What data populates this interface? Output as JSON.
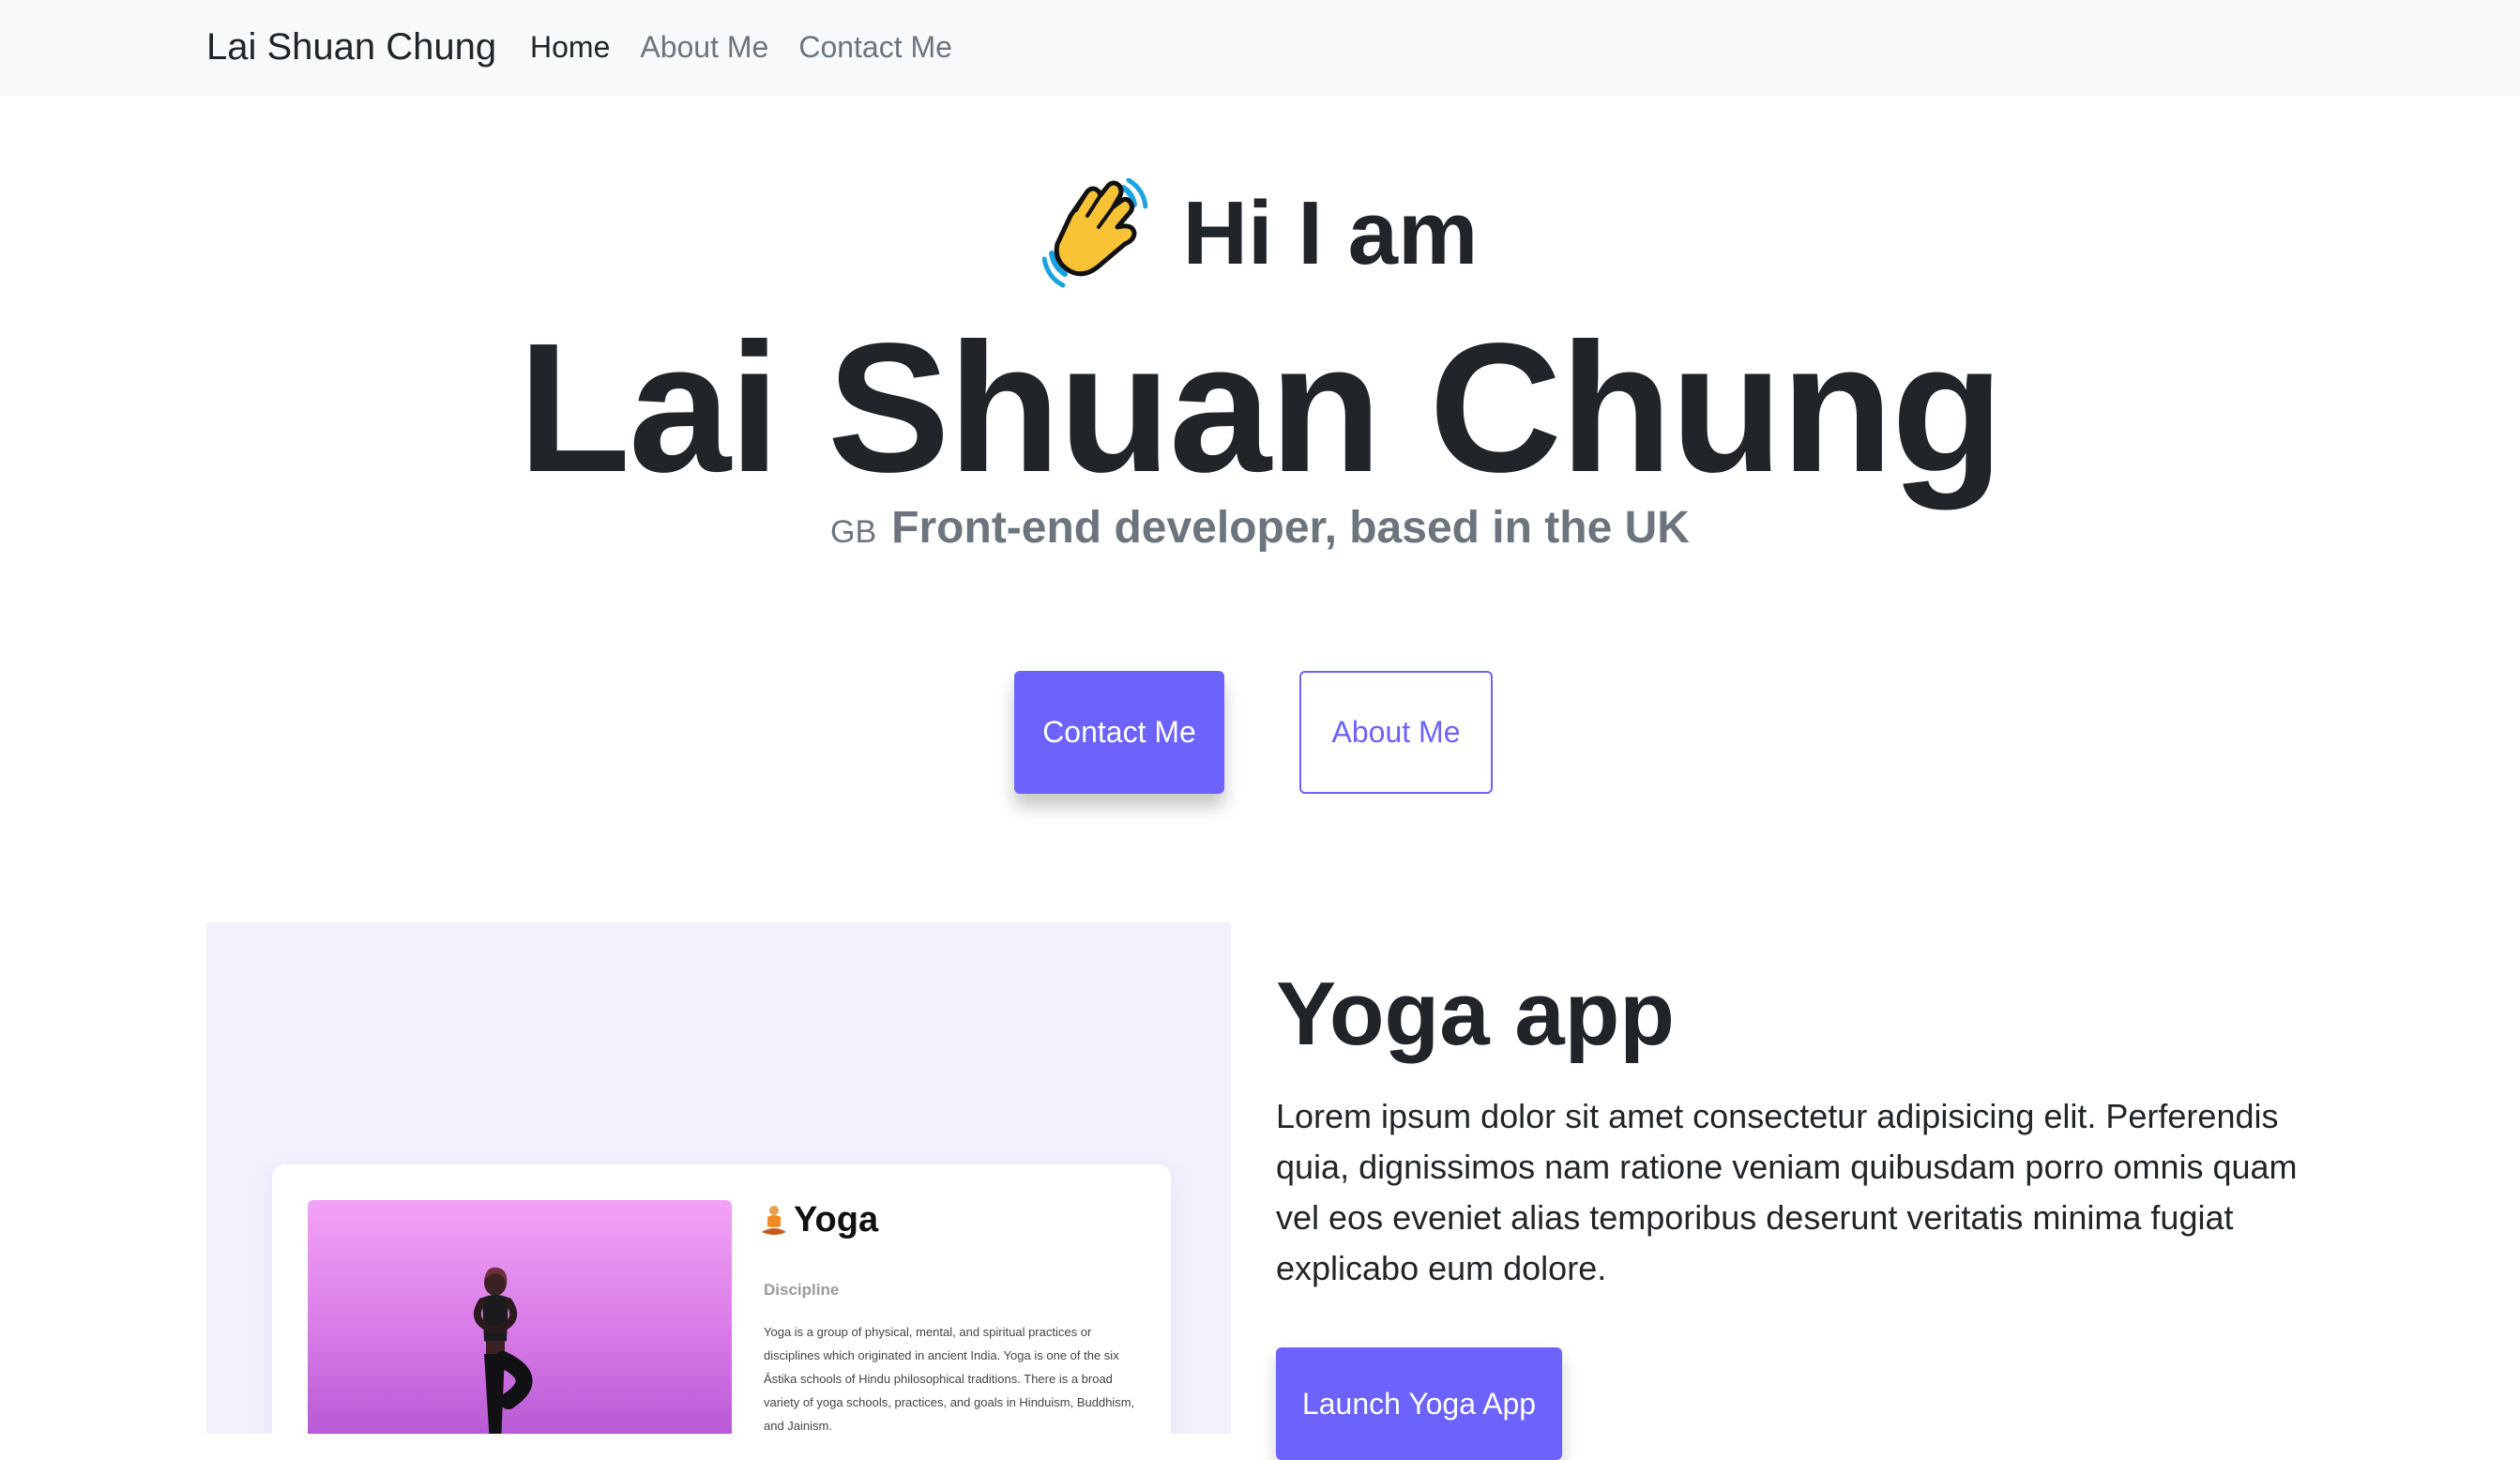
{
  "navbar": {
    "brand": "Lai Shuan Chung",
    "links": [
      {
        "label": "Home",
        "active": true
      },
      {
        "label": "About Me",
        "active": false
      },
      {
        "label": "Contact Me",
        "active": false
      }
    ]
  },
  "hero": {
    "greeting": "Hi I am",
    "greeting_icon": "waving-hand-icon",
    "name": "Lai Shuan Chung",
    "flag_code": "GB",
    "subtitle": "Front-end developer, based in the UK"
  },
  "buttons": {
    "contact_label": "Contact Me",
    "about_label": "About Me"
  },
  "project": {
    "preview": {
      "title": "Yoga",
      "title_icon": "meditation-icon",
      "discipline_label": "Discipline",
      "description": "Yoga is a group of physical, mental, and spiritual practices or disciplines which originated in ancient India. Yoga is one of the six Āstika schools of Hindu philosophical traditions. There is a broad variety of yoga schools, practices, and goals in Hinduism, Buddhism, and Jainism."
    },
    "title": "Yoga app",
    "description": "Lorem ipsum dolor sit amet consectetur adipisicing elit. Perferendis quia, dignissimos nam ratione veniam quibusdam porro omnis quam vel eos eveniet alias temporibus deserunt veritatis minima fugiat explicabo eum dolore.",
    "launch_label": "Launch Yoga App"
  },
  "colors": {
    "accent": "#6c63ff",
    "navbar_bg": "#f8f9fa",
    "muted_text": "#6c757d",
    "preview_bg": "#f3f1fb"
  }
}
